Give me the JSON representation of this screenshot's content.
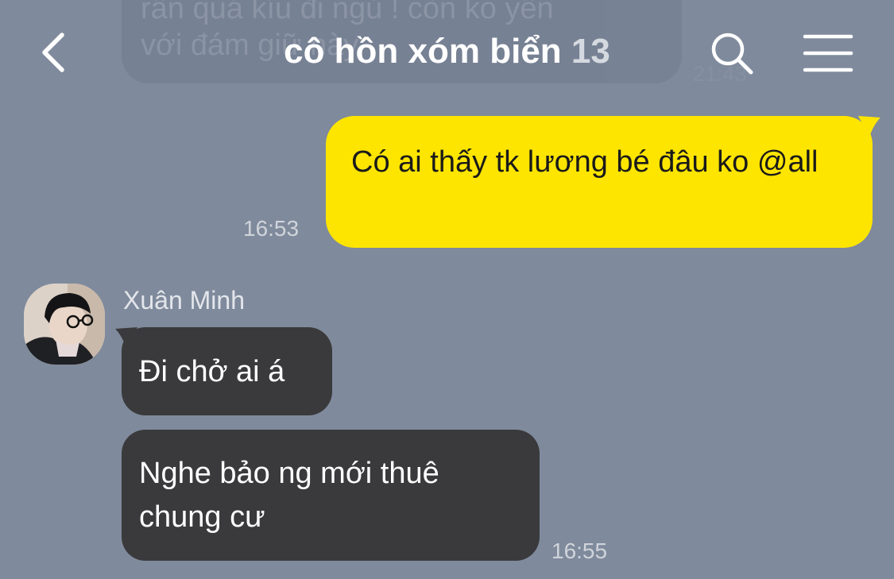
{
  "header": {
    "title": "cô hồn xóm biển",
    "member_count": "13",
    "back_icon": "chevron-left-icon",
    "search_icon": "search-icon",
    "menu_icon": "hamburger-menu-icon"
  },
  "faded_message": {
    "line1": "rần quá kíu đi ngủ ! còn ko yên",
    "line2": "với đám giữ này",
    "time": "21:43"
  },
  "messages": [
    {
      "sender": "me",
      "text": "Có ai thấy tk lương bé đâu ko @all",
      "time": "16:53"
    },
    {
      "sender": "Xuân Minh",
      "text": "Đi chở ai á"
    },
    {
      "sender": "Xuân Minh",
      "text": "Nghe bảo ng mới thuê chung cư",
      "time": "16:55"
    }
  ],
  "colors": {
    "background": "#7f8a9c",
    "my_bubble": "#fee500",
    "other_bubble": "#3a3a3c"
  }
}
